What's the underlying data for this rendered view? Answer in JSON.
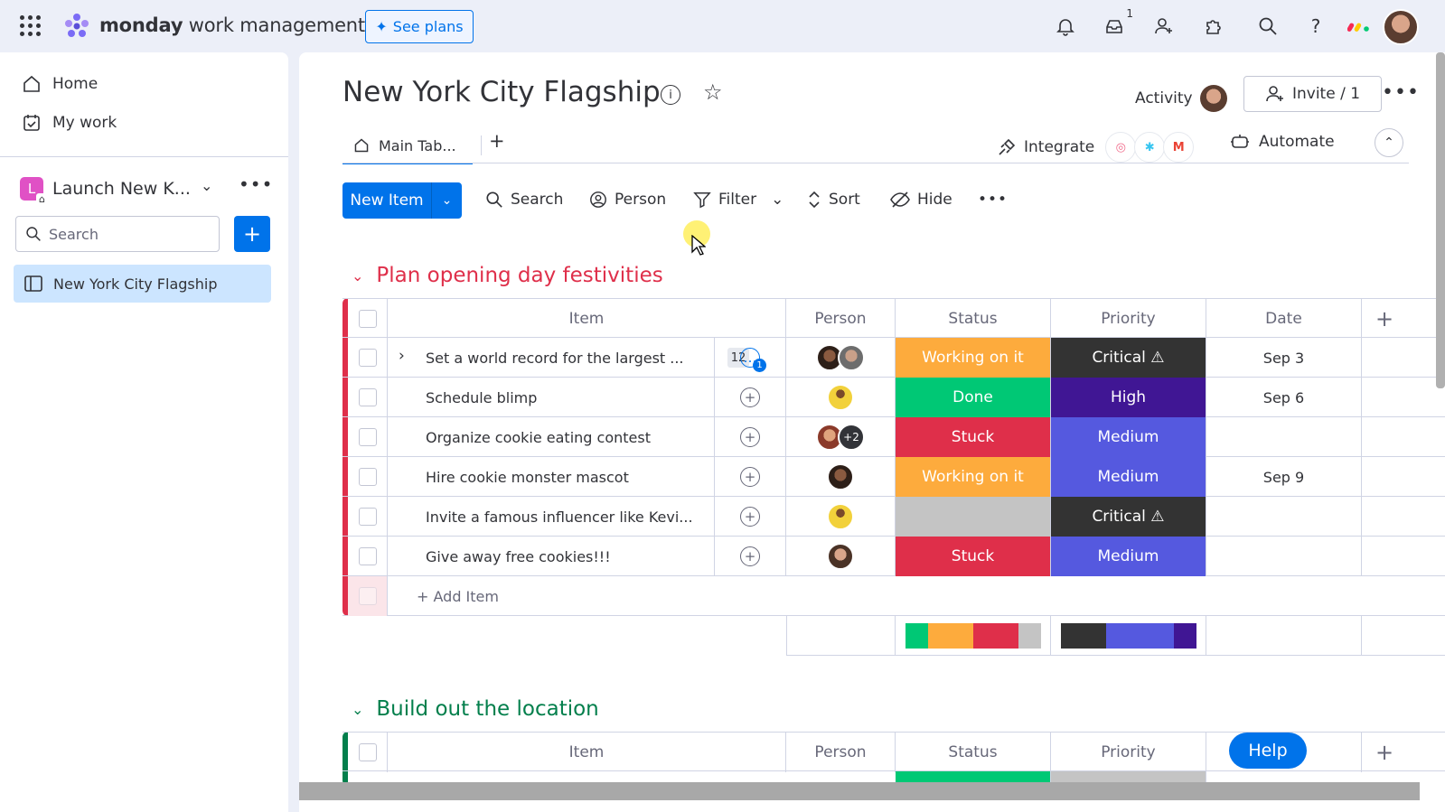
{
  "topbar": {
    "brand_bold": "monday",
    "brand_light": " work management",
    "see_plans": "See plans",
    "inbox_count": "1"
  },
  "sidebar": {
    "home": "Home",
    "my_work": "My work",
    "workspace_initial": "L",
    "workspace_name": "Launch New K...",
    "search_placeholder": "Search",
    "board_link": "New York City Flagship"
  },
  "board": {
    "title": "New York City Flagship",
    "activity": "Activity",
    "invite": "Invite / 1",
    "tab_main": "Main Tab...",
    "integrate": "Integrate",
    "automate": "Automate"
  },
  "toolbar": {
    "new_item": "New Item",
    "search": "Search",
    "person": "Person",
    "filter": "Filter",
    "sort": "Sort",
    "hide": "Hide"
  },
  "columns": {
    "item": "Item",
    "person": "Person",
    "status": "Status",
    "priority": "Priority",
    "date": "Date"
  },
  "colors": {
    "working": "#fdab3d",
    "done": "#00c875",
    "stuck": "#df2f4a",
    "critical": "#333333",
    "high": "#401694",
    "medium": "#5559df",
    "empty": "#c4c4c4",
    "group1": "#df2f4a",
    "group2": "#037f4c"
  },
  "groups": [
    {
      "title": "Plan opening day festivities",
      "add_item": "+ Add Item",
      "rows": [
        {
          "item": "Set a world record for the largest ...",
          "subitems": "12",
          "updates": "1",
          "status": "Working on it",
          "priority": "Critical ⚠",
          "date": "Sep 3"
        },
        {
          "item": "Schedule blimp",
          "status": "Done",
          "priority": "High",
          "date": "Sep 6"
        },
        {
          "item": "Organize cookie eating contest",
          "extra_people": "+2",
          "status": "Stuck",
          "priority": "Medium",
          "date": ""
        },
        {
          "item": "Hire cookie monster mascot",
          "status": "Working on it",
          "priority": "Medium",
          "date": "Sep 9"
        },
        {
          "item": "Invite a famous influencer like Kevi...",
          "status": "",
          "priority": "Critical ⚠",
          "date": ""
        },
        {
          "item": "Give away free cookies!!!",
          "status": "Stuck",
          "priority": "Medium",
          "date": ""
        }
      ]
    },
    {
      "title": "Build out the location"
    }
  ],
  "help": "Help"
}
